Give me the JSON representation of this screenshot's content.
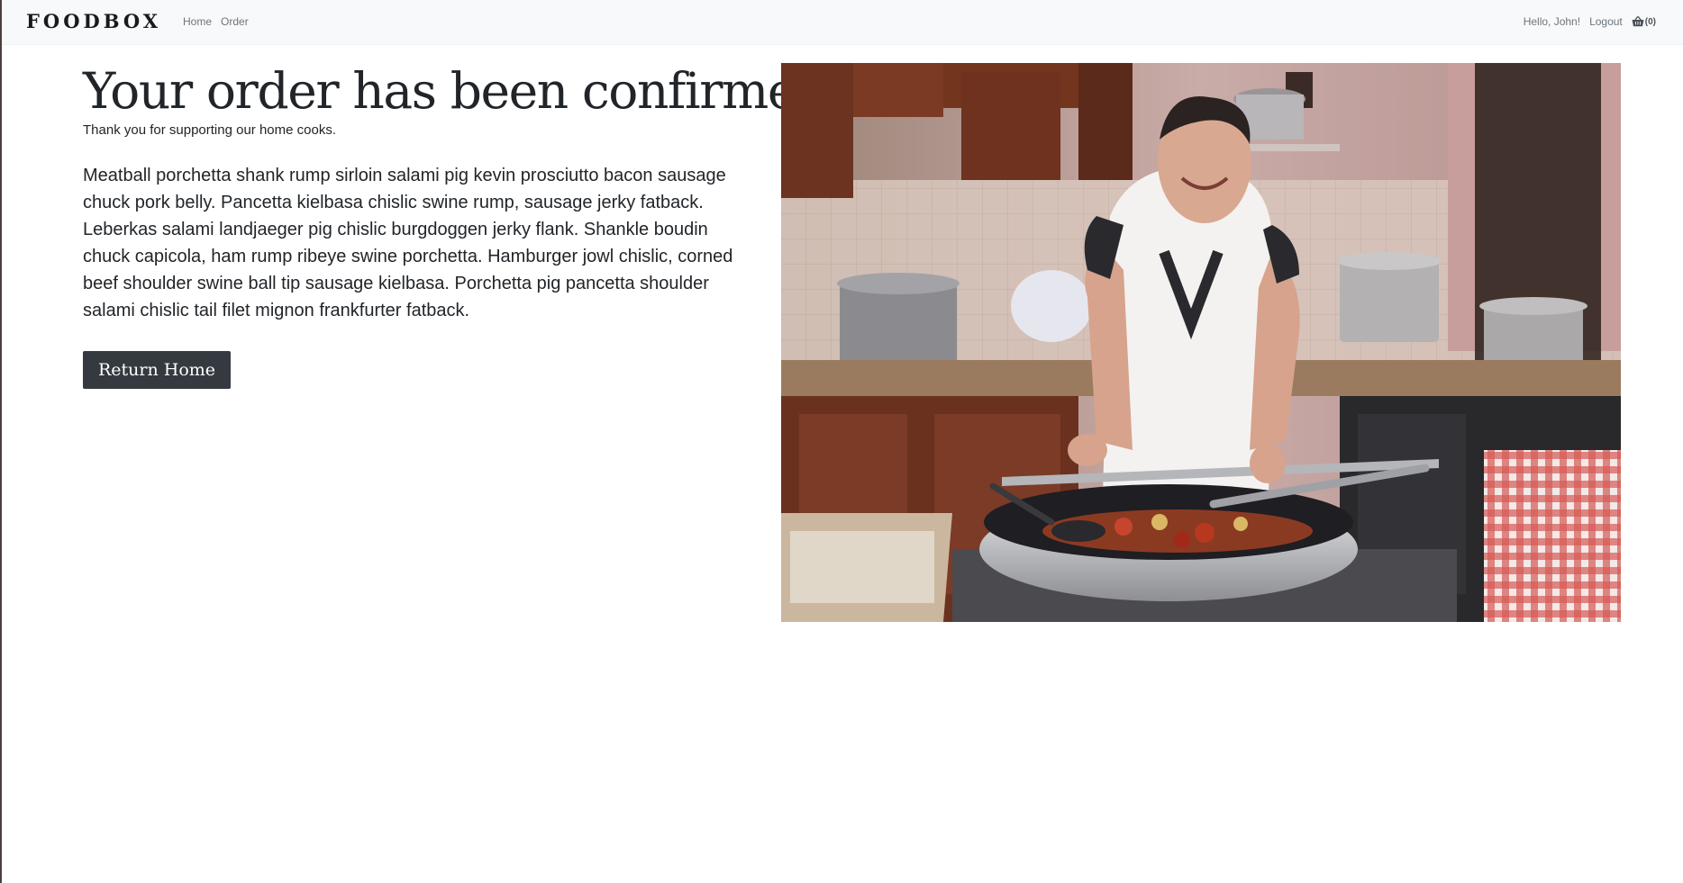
{
  "navbar": {
    "brand": "FOODBOX",
    "links": [
      {
        "label": "Home"
      },
      {
        "label": "Order"
      }
    ],
    "greeting": "Hello, John!",
    "logout_label": "Logout",
    "cart": {
      "icon": "shopping-basket-icon",
      "count_label": "(0)"
    }
  },
  "main": {
    "title": "Your order has been confirmed!",
    "subtitle": "Thank you for supporting our home cooks.",
    "body": "Meatball porchetta shank rump sirloin salami pig kevin prosciutto bacon sausage chuck pork belly. Pancetta kielbasa chislic swine rump, sausage jerky fatback. Leberkas salami landjaeger pig chislic burgdoggen jerky flank. Shankle boudin chuck capicola, ham rump ribeye swine porchetta. Hamburger jowl chislic, corned beef shoulder swine ball tip sausage kielbasa. Porchetta pig pancetta shoulder salami chislic tail filet mignon frankfurter fatback.",
    "return_button_label": "Return Home"
  },
  "hero_image": {
    "subject": "home-cook-photo"
  },
  "colors": {
    "navbar_bg": "#f8f9fa",
    "text": "#212529",
    "muted": "#6c757d",
    "button_bg": "#343a40",
    "button_text": "#ffffff"
  }
}
